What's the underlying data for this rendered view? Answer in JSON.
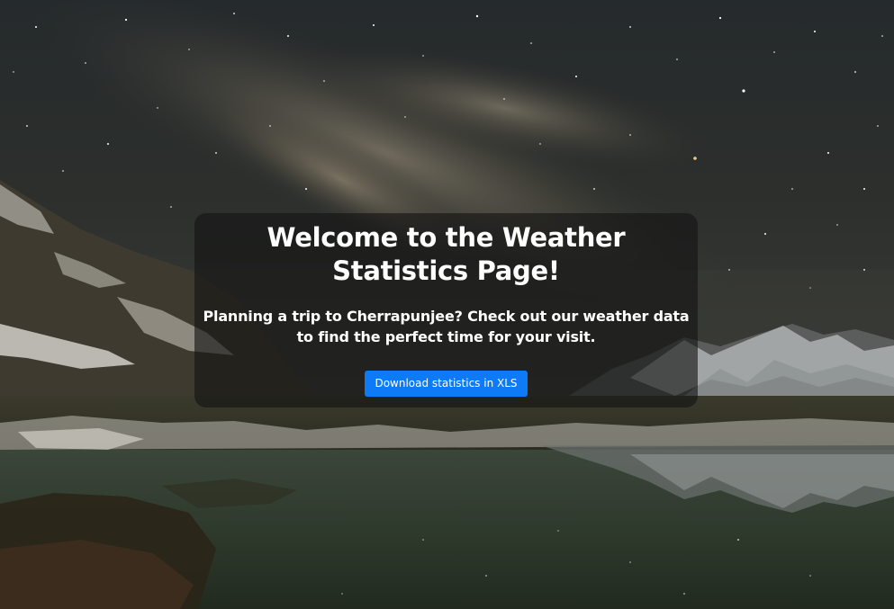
{
  "page": {
    "title": "Welcome to the Weather Statistics Page!",
    "description": "Planning a trip to Cherrapunjee? Check out our weather data to find the perfect time for your visit.",
    "download_button_label": "Download statistics in XLS"
  },
  "colors": {
    "button_background": "#0d7bf7",
    "card_overlay": "rgba(20,20,20,0.62)",
    "text": "#ffffff"
  },
  "background": {
    "subject": "night-sky-mountain-lake-photo"
  }
}
